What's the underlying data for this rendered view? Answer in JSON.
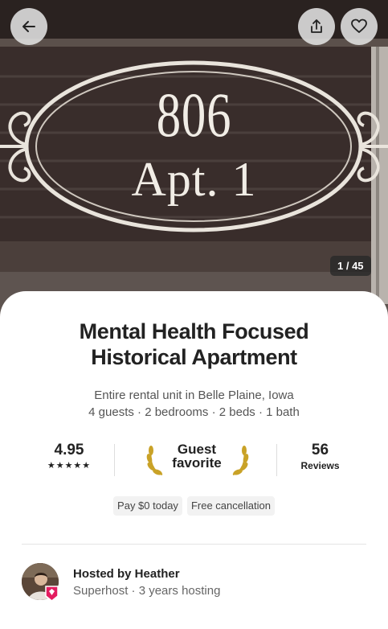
{
  "hero": {
    "sign_number": "806",
    "sign_apt": "Apt. 1",
    "photo_counter": "1 / 45",
    "back_icon": "arrow-left-icon",
    "share_icon": "share-icon",
    "save_icon": "heart-icon"
  },
  "listing": {
    "title": "Mental Health Focused Historical Apartment",
    "subtitle": "Entire rental unit in Belle Plaine, Iowa",
    "details": "4 guests · 2 bedrooms · 2 beds · 1 bath"
  },
  "stats": {
    "rating": "4.95",
    "stars": "★★★★★",
    "guest_favorite_line1": "Guest",
    "guest_favorite_line2": "favorite",
    "reviews_count": "56",
    "reviews_label": "Reviews"
  },
  "chips": [
    "Pay $0 today",
    "Free cancellation"
  ],
  "host": {
    "hosted_by": "Hosted by Heather",
    "meta": "Superhost · 3 years hosting"
  },
  "colors": {
    "accent": "#e31c5f",
    "laurel_gold": "#c9a227",
    "text_primary": "#222222",
    "text_secondary": "#555555"
  }
}
